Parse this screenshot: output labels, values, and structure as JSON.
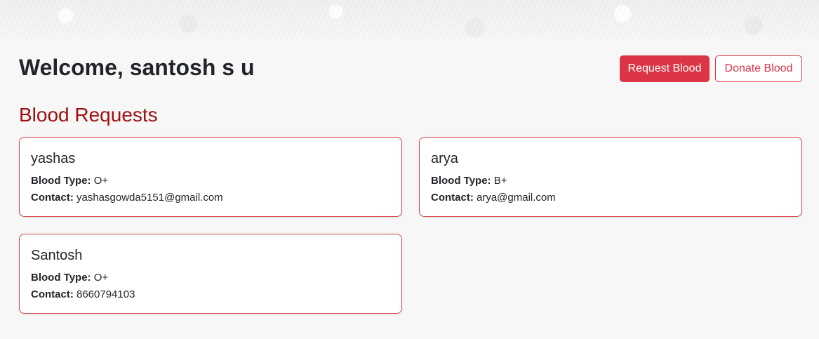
{
  "header": {
    "welcome_text": "Welcome, santosh s u",
    "request_button_label": "Request Blood",
    "donate_button_label": "Donate Blood"
  },
  "section": {
    "title": "Blood Requests",
    "blood_type_label": "Blood Type:",
    "contact_label": "Contact:"
  },
  "requests": [
    {
      "name": "yashas",
      "blood_type": "O+",
      "contact": "yashasgowda5151@gmail.com"
    },
    {
      "name": "arya",
      "blood_type": "B+",
      "contact": "arya@gmail.com"
    },
    {
      "name": "Santosh",
      "blood_type": "O+",
      "contact": "8660794103"
    }
  ],
  "colors": {
    "primary_red": "#dc3545",
    "section_title_red": "#a00f0f",
    "background": "#f7f7f7"
  }
}
